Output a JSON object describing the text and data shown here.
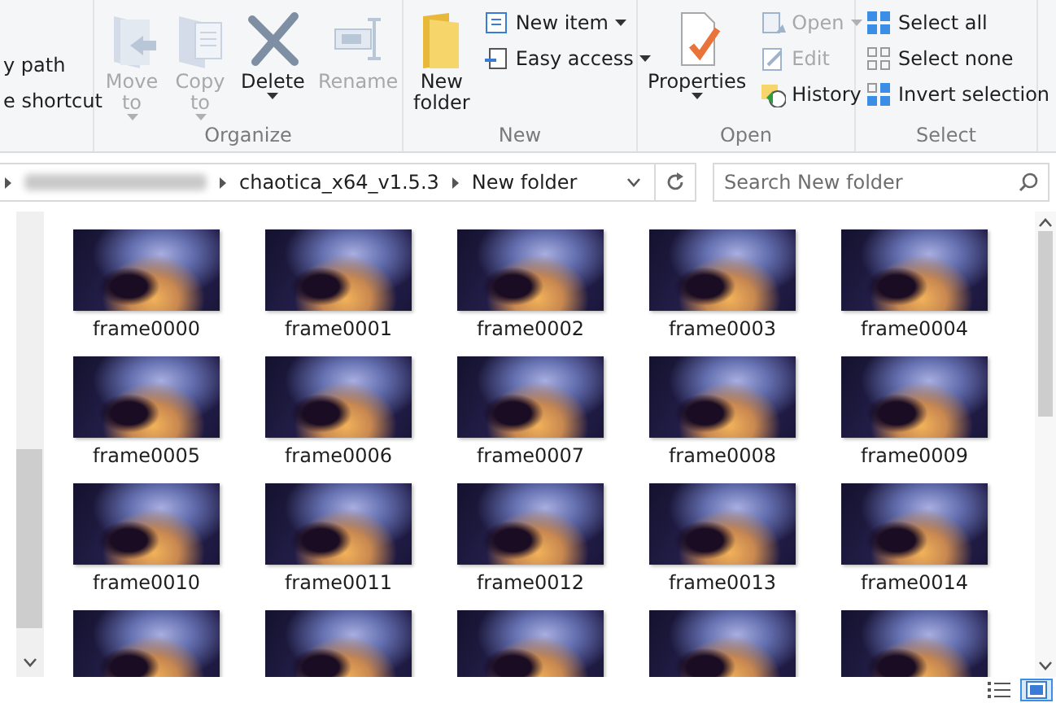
{
  "ribbon": {
    "groups": [
      {
        "items": [
          {
            "kind": "small",
            "label": "y path",
            "disabled": false,
            "dropdown": false
          },
          {
            "kind": "small",
            "label": "e shortcut",
            "disabled": false,
            "dropdown": false
          }
        ]
      },
      {
        "label": "Organize",
        "items": [
          {
            "kind": "large",
            "label": "Move to",
            "disabled": true,
            "dropdown": true
          },
          {
            "kind": "large",
            "label": "Copy to",
            "disabled": true,
            "dropdown": true
          },
          {
            "kind": "large",
            "label": "Delete",
            "disabled": false,
            "dropdown": true
          },
          {
            "kind": "large",
            "label": "Rename",
            "disabled": true,
            "dropdown": false
          }
        ]
      },
      {
        "label": "New",
        "items": [
          {
            "kind": "large",
            "label": "New folder",
            "disabled": false,
            "dropdown": false
          },
          {
            "kind": "small",
            "label": "New item",
            "disabled": false,
            "dropdown": true
          },
          {
            "kind": "small",
            "label": "Easy access",
            "disabled": false,
            "dropdown": true
          }
        ]
      },
      {
        "label": "Open",
        "items": [
          {
            "kind": "large",
            "label": "Properties",
            "disabled": false,
            "dropdown": true
          },
          {
            "kind": "small",
            "label": "Open",
            "disabled": true,
            "dropdown": true
          },
          {
            "kind": "small",
            "label": "Edit",
            "disabled": true,
            "dropdown": false
          },
          {
            "kind": "small",
            "label": "History",
            "disabled": false,
            "dropdown": false
          }
        ]
      },
      {
        "label": "Select",
        "items": [
          {
            "kind": "small",
            "label": "Select all",
            "disabled": false,
            "dropdown": false
          },
          {
            "kind": "small",
            "label": "Select none",
            "disabled": false,
            "dropdown": false
          },
          {
            "kind": "small",
            "label": "Invert selection",
            "disabled": false,
            "dropdown": false
          }
        ]
      }
    ]
  },
  "address_bar": {
    "path": [
      "chaotica_x64_v1.5.3",
      "New folder"
    ]
  },
  "search": {
    "placeholder": "Search New folder"
  },
  "files": [
    {
      "name": "frame0000",
      "selected": false
    },
    {
      "name": "frame0001",
      "selected": false
    },
    {
      "name": "frame0002",
      "selected": false
    },
    {
      "name": "frame0003",
      "selected": false
    },
    {
      "name": "frame0004",
      "selected": false
    },
    {
      "name": "frame0005",
      "selected": false
    },
    {
      "name": "frame0006",
      "selected": false
    },
    {
      "name": "frame0007",
      "selected": false
    },
    {
      "name": "frame0008",
      "selected": false
    },
    {
      "name": "frame0009",
      "selected": false
    },
    {
      "name": "frame0010",
      "selected": false
    },
    {
      "name": "frame0011",
      "selected": false
    },
    {
      "name": "frame0012",
      "selected": false
    },
    {
      "name": "frame0013",
      "selected": false
    },
    {
      "name": "frame0014",
      "selected": false
    },
    {
      "selected": false
    },
    {
      "selected": false
    },
    {
      "selected": false
    },
    {
      "selected": false
    },
    {
      "selected": false
    }
  ],
  "status_bar": {
    "views": [
      {
        "selected": false
      },
      {
        "selected": true
      }
    ]
  }
}
